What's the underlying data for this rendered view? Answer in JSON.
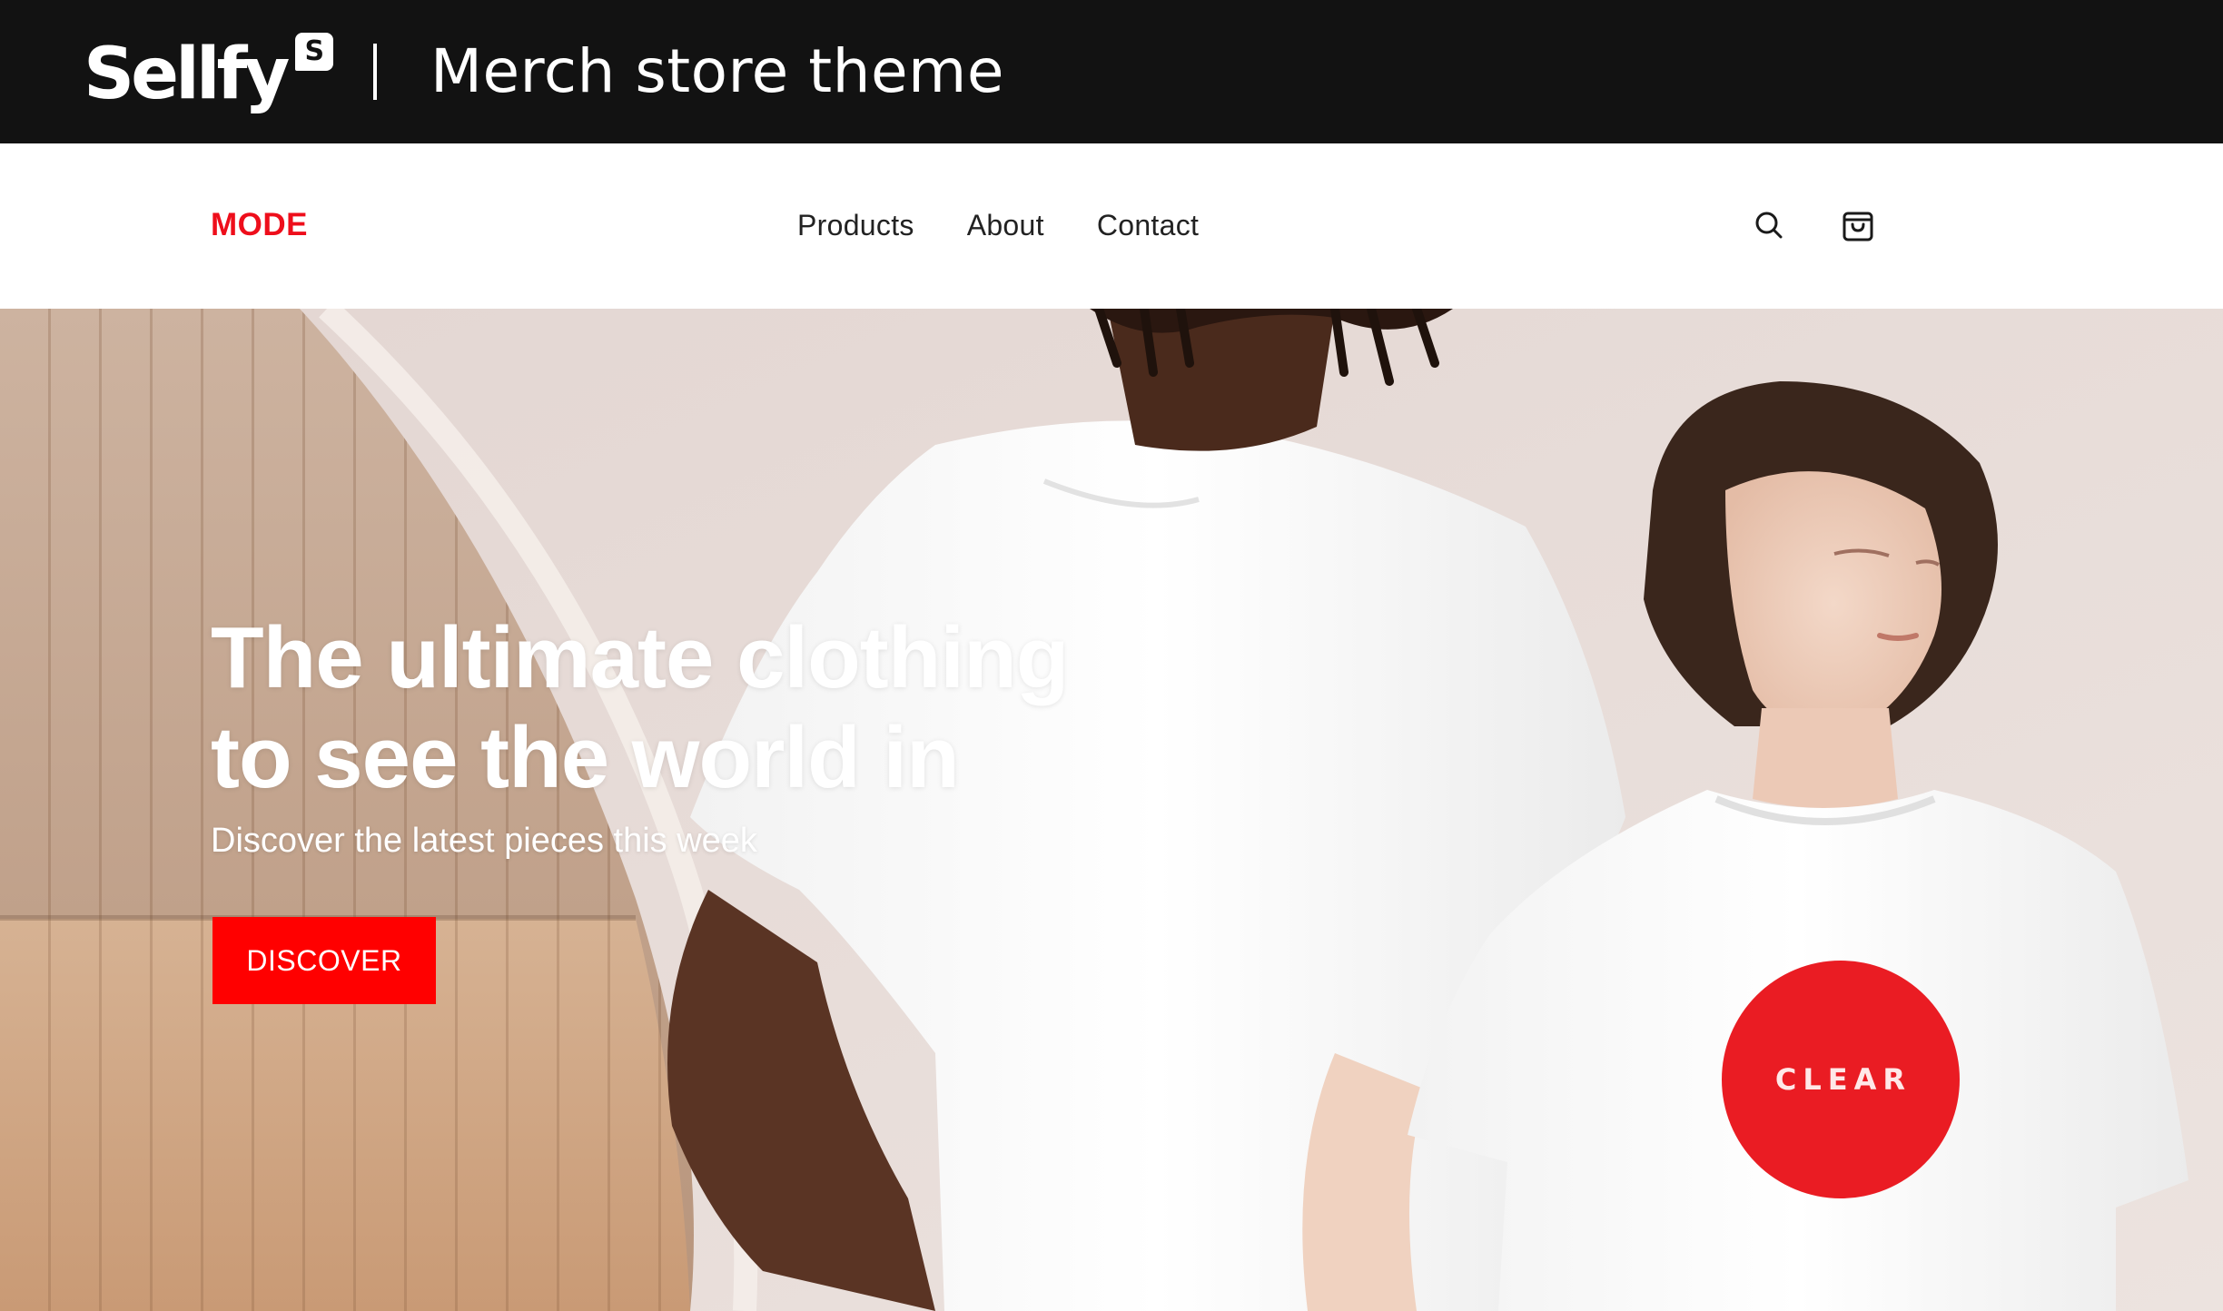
{
  "banner": {
    "logo_text": "Sellfy",
    "logo_badge": "S",
    "title": "Merch store theme",
    "background": "#121212"
  },
  "navbar": {
    "brand": "MODE",
    "brand_color": "#ee0e1b",
    "links": [
      {
        "label": "Products"
      },
      {
        "label": "About"
      },
      {
        "label": "Contact"
      }
    ],
    "icons": [
      "search-icon",
      "shopping-bag-icon"
    ]
  },
  "hero": {
    "title_line1": "The ultimate clothing",
    "title_line2": "to see the world in",
    "subtitle": "Discover the latest pieces this week",
    "cta_label": "DISCOVER",
    "cta_color": "#ff0000",
    "shirt_print": "CLEAR",
    "shirt_print_color": "#ea1c23"
  }
}
